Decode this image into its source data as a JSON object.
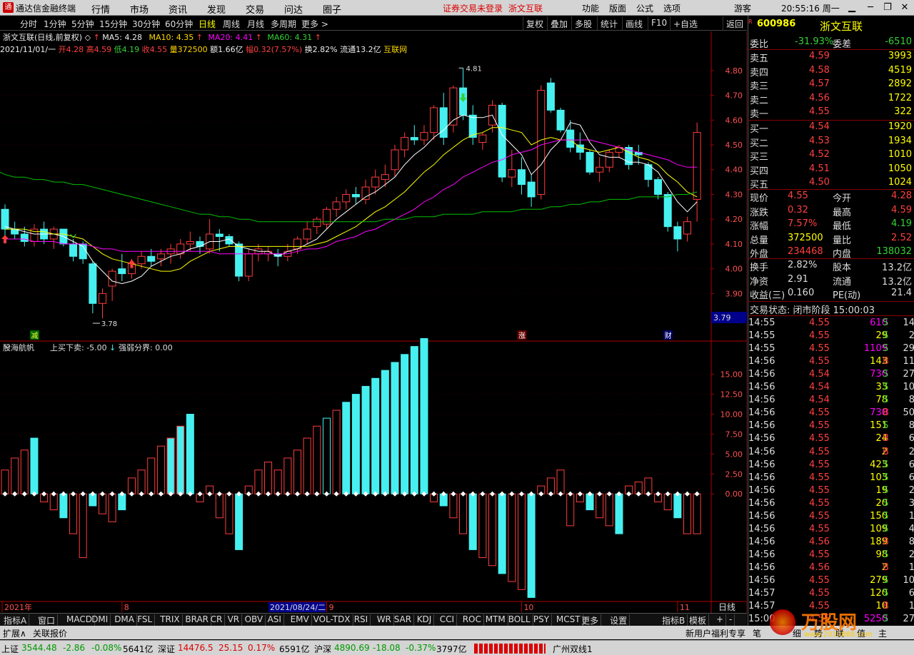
{
  "titlebar": {
    "app": "通达信金融终端",
    "menus": [
      "行情",
      "市场",
      "资讯",
      "发现",
      "交易",
      "问达",
      "圈子"
    ],
    "warn": "证券交易未登录",
    "stock": "浙文互联",
    "right": [
      "功能",
      "版面",
      "公式",
      "选项"
    ],
    "guest": "游客",
    "clock": "20:55:16 周一"
  },
  "toolbar": {
    "periods": [
      "分时",
      "1分钟",
      "5分钟",
      "15分钟",
      "30分钟",
      "60分钟",
      "日线",
      "周线",
      "月线",
      "多周期",
      "更多 >"
    ],
    "active": "日线",
    "buttons": [
      "复权",
      "叠加",
      "多股",
      "统计",
      "画线",
      "F10",
      "+自选",
      "返回"
    ]
  },
  "chart": {
    "name": "浙文互联(日线,前复权)",
    "ma5": "MA5: 4.28",
    "ma10": "MA10: 4.35",
    "ma20": "MA20: 4.41",
    "ma60": "MA60: 4.31",
    "quote": {
      "date": "2021/11/01/一",
      "open": "开4.28",
      "high": "高4.59",
      "low": "低4.19",
      "close": "收4.55",
      "vol": "量372500",
      "amt": "额1.66亿",
      "amp": "幅0.32(7.57%)",
      "turn": "换2.82%",
      "float": "流通13.2亿",
      "tag": "互联网"
    },
    "ylabels": [
      "4.80",
      "4.70",
      "4.60",
      "4.50",
      "4.40",
      "4.30",
      "4.20",
      "4.10",
      "4.00",
      "3.90"
    ],
    "cursor_price": "3.79",
    "high_mark": "4.81",
    "low_mark": "3.78",
    "events": [
      "减",
      "涨",
      "财"
    ],
    "xlabels": [
      "2021年",
      "8",
      "9",
      "10",
      "11"
    ],
    "cursor_date": "2021/08/24/二",
    "ind_name": "股海航帆",
    "ind_p1": "上买下卖: -5.00",
    "ind_arrow": "↓",
    "ind_p2": "强弱分界: 0.00",
    "ind_ylabels": [
      "15.00",
      "12.50",
      "10.00",
      "7.50",
      "5.00",
      "2.50",
      "0.00"
    ],
    "corner": "日线"
  },
  "chart_data": {
    "type": "candlestick",
    "candles": [
      [
        4.24,
        4.26,
        4.13,
        4.16
      ],
      [
        4.16,
        4.19,
        4.12,
        4.14
      ],
      [
        4.14,
        4.17,
        4.09,
        4.11
      ],
      [
        4.11,
        4.18,
        4.09,
        4.16
      ],
      [
        4.16,
        4.19,
        4.1,
        4.12
      ],
      [
        4.12,
        4.17,
        4.08,
        4.16
      ],
      [
        4.16,
        4.16,
        4.09,
        4.1
      ],
      [
        4.1,
        4.12,
        4.03,
        4.05
      ],
      [
        4.1,
        4.11,
        4.02,
        4.04
      ],
      [
        4.02,
        4.03,
        3.82,
        3.86
      ],
      [
        3.86,
        3.92,
        3.8,
        3.9
      ],
      [
        3.93,
        4.0,
        3.87,
        3.99
      ],
      [
        4.0,
        4.06,
        3.95,
        3.98
      ],
      [
        3.98,
        4.04,
        3.96,
        4.02
      ],
      [
        4.02,
        4.07,
        4.0,
        4.05
      ],
      [
        4.05,
        4.08,
        4.01,
        4.03
      ],
      [
        4.04,
        4.08,
        4.01,
        4.06
      ],
      [
        4.06,
        4.1,
        4.02,
        4.08
      ],
      [
        4.06,
        4.12,
        4.04,
        4.1
      ],
      [
        4.1,
        4.15,
        4.07,
        4.11
      ],
      [
        4.11,
        4.13,
        4.06,
        4.09
      ],
      [
        4.08,
        4.2,
        4.06,
        4.14
      ],
      [
        4.14,
        4.16,
        4.07,
        4.13
      ],
      [
        4.13,
        4.14,
        4.09,
        4.1
      ],
      [
        4.1,
        4.11,
        3.95,
        3.97
      ],
      [
        3.97,
        4.08,
        3.95,
        4.06
      ],
      [
        4.06,
        4.1,
        4.03,
        4.08
      ],
      [
        4.06,
        4.09,
        4.03,
        4.07
      ],
      [
        4.06,
        4.08,
        4.01,
        4.05
      ],
      [
        4.05,
        4.1,
        4.03,
        4.07
      ],
      [
        4.08,
        4.13,
        4.06,
        4.12
      ],
      [
        4.12,
        4.19,
        4.1,
        4.16
      ],
      [
        4.17,
        4.21,
        4.14,
        4.2
      ],
      [
        4.18,
        4.25,
        4.16,
        4.24
      ],
      [
        4.24,
        4.29,
        4.21,
        4.27
      ],
      [
        4.27,
        4.32,
        4.24,
        4.3
      ],
      [
        4.3,
        4.33,
        4.26,
        4.29
      ],
      [
        4.28,
        4.36,
        4.26,
        4.33
      ],
      [
        4.33,
        4.4,
        4.3,
        4.37
      ],
      [
        4.36,
        4.42,
        4.33,
        4.38
      ],
      [
        4.4,
        4.5,
        4.37,
        4.48
      ],
      [
        4.48,
        4.55,
        4.45,
        4.53
      ],
      [
        4.53,
        4.58,
        4.5,
        4.52
      ],
      [
        4.52,
        4.58,
        4.5,
        4.55
      ],
      [
        4.55,
        4.66,
        4.52,
        4.65
      ],
      [
        4.65,
        4.71,
        4.5,
        4.53
      ],
      [
        4.58,
        4.74,
        4.55,
        4.73
      ],
      [
        4.73,
        4.81,
        4.6,
        4.62
      ],
      [
        4.62,
        4.66,
        4.5,
        4.53
      ],
      [
        4.51,
        4.55,
        4.48,
        4.54
      ],
      [
        4.58,
        4.68,
        4.55,
        4.66
      ],
      [
        4.66,
        4.67,
        4.35,
        4.37
      ],
      [
        4.37,
        4.48,
        4.33,
        4.4
      ],
      [
        4.4,
        4.45,
        4.3,
        4.34
      ],
      [
        4.35,
        4.38,
        4.25,
        4.29
      ],
      [
        4.3,
        4.74,
        4.28,
        4.72
      ],
      [
        4.75,
        4.77,
        4.63,
        4.64
      ],
      [
        4.64,
        4.65,
        4.55,
        4.56
      ],
      [
        4.56,
        4.6,
        4.47,
        4.49
      ],
      [
        4.5,
        4.55,
        4.44,
        4.47
      ],
      [
        4.47,
        4.48,
        4.38,
        4.39
      ],
      [
        4.39,
        4.45,
        4.35,
        4.41
      ],
      [
        4.41,
        4.48,
        4.39,
        4.47
      ],
      [
        4.47,
        4.5,
        4.45,
        4.49
      ],
      [
        4.49,
        4.5,
        4.4,
        4.42
      ],
      [
        4.47,
        4.5,
        4.42,
        4.46
      ],
      [
        4.42,
        4.43,
        4.33,
        4.36
      ],
      [
        4.36,
        4.37,
        4.28,
        4.3
      ],
      [
        4.3,
        4.31,
        4.15,
        4.17
      ],
      [
        4.17,
        4.19,
        4.07,
        4.12
      ],
      [
        4.14,
        4.21,
        4.11,
        4.19
      ],
      [
        4.28,
        4.59,
        4.19,
        4.55
      ]
    ],
    "ma5": [
      4.17,
      4.16,
      4.15,
      4.14,
      4.14,
      4.14,
      4.13,
      4.11,
      4.09,
      4.03,
      3.99,
      3.95,
      3.94,
      3.95,
      3.97,
      4.01,
      4.03,
      4.05,
      4.06,
      4.08,
      4.09,
      4.11,
      4.11,
      4.12,
      4.09,
      4.08,
      4.07,
      4.07,
      4.05,
      4.07,
      4.08,
      4.1,
      4.12,
      4.16,
      4.2,
      4.23,
      4.26,
      4.29,
      4.31,
      4.34,
      4.37,
      4.42,
      4.46,
      4.49,
      4.53,
      4.56,
      4.6,
      4.62,
      4.61,
      4.61,
      4.62,
      4.54,
      4.5,
      4.46,
      4.38,
      4.42,
      4.48,
      4.52,
      4.59,
      4.58,
      4.51,
      4.46,
      4.45,
      4.45,
      4.43,
      4.43,
      4.42,
      4.39,
      4.33,
      4.27,
      4.23,
      4.27
    ],
    "ma10": [
      4.16,
      4.16,
      4.16,
      4.15,
      4.15,
      4.14,
      4.14,
      4.13,
      4.12,
      4.09,
      4.06,
      4.04,
      4.03,
      4.02,
      4.01,
      4.0,
      3.99,
      3.99,
      4.0,
      4.03,
      4.05,
      4.07,
      4.08,
      4.09,
      4.09,
      4.09,
      4.09,
      4.09,
      4.09,
      4.09,
      4.09,
      4.09,
      4.1,
      4.11,
      4.13,
      4.15,
      4.17,
      4.2,
      4.23,
      4.25,
      4.28,
      4.31,
      4.35,
      4.39,
      4.42,
      4.46,
      4.49,
      4.52,
      4.54,
      4.55,
      4.57,
      4.57,
      4.56,
      4.55,
      4.5,
      4.52,
      4.53,
      4.52,
      4.52,
      4.49,
      4.48,
      4.47,
      4.48,
      4.49,
      4.47,
      4.45,
      4.44,
      4.42,
      4.38,
      4.35,
      4.31,
      4.29
    ],
    "ma20": [
      4.12,
      4.12,
      4.12,
      4.11,
      4.11,
      4.11,
      4.1,
      4.1,
      4.1,
      4.09,
      4.08,
      4.08,
      4.07,
      4.07,
      4.07,
      4.07,
      4.07,
      4.07,
      4.07,
      4.07,
      4.07,
      4.07,
      4.06,
      4.06,
      4.06,
      4.06,
      4.06,
      4.06,
      4.06,
      4.06,
      4.07,
      4.08,
      4.08,
      4.09,
      4.11,
      4.12,
      4.13,
      4.15,
      4.16,
      4.18,
      4.2,
      4.22,
      4.24,
      4.27,
      4.29,
      4.32,
      4.34,
      4.37,
      4.39,
      4.41,
      4.43,
      4.44,
      4.46,
      4.47,
      4.48,
      4.5,
      4.51,
      4.52,
      4.52,
      4.52,
      4.52,
      4.51,
      4.5,
      4.49,
      4.48,
      4.47,
      4.46,
      4.45,
      4.44,
      4.42,
      4.41,
      4.41
    ],
    "ma60": [
      4.38,
      4.37,
      4.37,
      4.36,
      4.36,
      4.35,
      4.35,
      4.34,
      4.34,
      4.33,
      4.32,
      4.31,
      4.3,
      4.29,
      4.28,
      4.27,
      4.26,
      4.25,
      4.24,
      4.23,
      4.22,
      4.22,
      4.21,
      4.21,
      4.2,
      4.2,
      4.19,
      4.19,
      4.19,
      4.19,
      4.19,
      4.19,
      4.19,
      4.19,
      4.19,
      4.19,
      4.19,
      4.19,
      4.19,
      4.2,
      4.2,
      4.2,
      4.21,
      4.21,
      4.21,
      4.22,
      4.22,
      4.22,
      4.22,
      4.23,
      4.23,
      4.23,
      4.23,
      4.24,
      4.24,
      4.24,
      4.25,
      4.25,
      4.26,
      4.26,
      4.27,
      4.27,
      4.28,
      4.28,
      4.28,
      4.29,
      4.29,
      4.29,
      4.29,
      4.3,
      4.3,
      4.31
    ],
    "indicator": [
      3,
      4.5,
      5.5,
      7,
      -1,
      -2,
      -3,
      -5,
      -8,
      -1.5,
      -2.5,
      -3.5,
      -2,
      2,
      3,
      4.5,
      6,
      7,
      8.5,
      10,
      -1,
      1,
      -3,
      -5,
      -7,
      1,
      3,
      4,
      3,
      4.5,
      5.5,
      7,
      8.5,
      9.5,
      10.5,
      11.5,
      12.5,
      13.5,
      14.5,
      15.5,
      16.5,
      17.5,
      18.5,
      19.5,
      -1,
      -1.5,
      -3,
      -5,
      -7,
      -8,
      -9,
      -10,
      -11,
      -12,
      -13,
      1,
      2,
      3,
      -4,
      -1,
      -2,
      -3,
      -4,
      -5,
      1,
      1.5,
      2,
      -1,
      -2,
      -3,
      -5,
      -5
    ],
    "ylim": [
      3.76,
      4.86
    ],
    "ind_ylim": [
      -13.5,
      19
    ]
  },
  "rightpanel": {
    "code": "600986",
    "name": "浙文互联",
    "weibi": {
      "l1": "委比",
      "v1": "-31.93%",
      "l2": "委差",
      "v2": "-6510"
    },
    "asks": [
      {
        "l": "卖五",
        "p": "4.59",
        "v": "3993"
      },
      {
        "l": "卖四",
        "p": "4.58",
        "v": "4519"
      },
      {
        "l": "卖三",
        "p": "4.57",
        "v": "2892"
      },
      {
        "l": "卖二",
        "p": "4.56",
        "v": "1722"
      },
      {
        "l": "卖一",
        "p": "4.55",
        "v": "322"
      }
    ],
    "bids": [
      {
        "l": "买一",
        "p": "4.54",
        "v": "1920"
      },
      {
        "l": "买二",
        "p": "4.53",
        "v": "1934"
      },
      {
        "l": "买三",
        "p": "4.52",
        "v": "1010"
      },
      {
        "l": "买四",
        "p": "4.51",
        "v": "1050"
      },
      {
        "l": "买五",
        "p": "4.50",
        "v": "1024"
      }
    ],
    "stats1": [
      [
        "现价",
        "4.55",
        "今开",
        "4.28"
      ],
      [
        "涨跌",
        "0.32",
        "最高",
        "4.59"
      ],
      [
        "涨幅",
        "7.57%",
        "最低",
        "4.19"
      ],
      [
        "总量",
        "372500",
        "量比",
        "2.52"
      ],
      [
        "外盘",
        "234468",
        "内盘",
        "138032"
      ]
    ],
    "stats2": [
      [
        "换手",
        "2.82%",
        "股本",
        "13.2亿"
      ],
      [
        "净资",
        "2.91",
        "流通",
        "13.2亿"
      ],
      [
        "收益(三)",
        "0.160",
        "PE(动)",
        "21.4"
      ]
    ],
    "status": "交易状态: 闭市阶段 15:00:03",
    "ticks": [
      [
        "14:55",
        "4.55",
        "610",
        "S",
        "14"
      ],
      [
        "14:55",
        "4.55",
        "29",
        "S",
        "2"
      ],
      [
        "14:55",
        "4.55",
        "1109",
        "S",
        "29"
      ],
      [
        "14:56",
        "4.55",
        "143",
        "B",
        "11"
      ],
      [
        "14:56",
        "4.54",
        "730",
        "S",
        "27"
      ],
      [
        "14:56",
        "4.54",
        "33",
        "S",
        "10"
      ],
      [
        "14:56",
        "4.54",
        "78",
        "S",
        "8"
      ],
      [
        "14:56",
        "4.55",
        "730",
        "B",
        "50"
      ],
      [
        "14:56",
        "4.55",
        "151",
        "S",
        "8"
      ],
      [
        "14:56",
        "4.55",
        "24",
        "B",
        "6"
      ],
      [
        "14:56",
        "4.55",
        "2",
        "B",
        "2"
      ],
      [
        "14:56",
        "4.55",
        "423",
        "S",
        "6"
      ],
      [
        "14:56",
        "4.55",
        "103",
        "S",
        "6"
      ],
      [
        "14:56",
        "4.55",
        "19",
        "S",
        "2"
      ],
      [
        "14:56",
        "4.55",
        "20",
        "S",
        "3"
      ],
      [
        "14:56",
        "4.55",
        "150",
        "S",
        "1"
      ],
      [
        "14:56",
        "4.55",
        "109",
        "S",
        "4"
      ],
      [
        "14:56",
        "4.56",
        "189",
        "B",
        "8"
      ],
      [
        "14:56",
        "4.55",
        "98",
        "S",
        "2"
      ],
      [
        "14:56",
        "4.56",
        "2",
        "B",
        "1"
      ],
      [
        "14:56",
        "4.55",
        "279",
        "S",
        "10"
      ],
      [
        "14:57",
        "4.55",
        "120",
        "S",
        "6"
      ],
      [
        "14:57",
        "4.55",
        "10",
        "B",
        "1"
      ],
      [
        "15:00",
        "4.55",
        "5250",
        "S",
        "27"
      ]
    ]
  },
  "bottomtabs": [
    "指标A",
    "窗口",
    "MACD",
    "DMI",
    "DMA",
    "FSL",
    "TRIX",
    "BRAR",
    "CR",
    "VR",
    "OBV",
    "ASI",
    "EMV",
    "VOL-TDX",
    "RSI",
    "WR",
    "SAR",
    "KDJ",
    "CCI",
    "ROC",
    "MTM",
    "BOLL",
    "PSY",
    "MCST",
    "更多",
    "设置"
  ],
  "bottomright": [
    "指标B",
    "模板",
    "+",
    "-"
  ],
  "extbar": {
    "left": [
      "扩展∧",
      "关联报价"
    ],
    "right": "新用户福利专享",
    "tabs": [
      "笔",
      "细",
      "势",
      "联",
      "值",
      "主"
    ]
  },
  "watermark": {
    "text": "万股网",
    "url": "www.2010888.com"
  },
  "statusbar": {
    "items": [
      {
        "n": "上证",
        "v": "3544.48",
        "c": "-2.86",
        "p": "-0.08%",
        "a": "5641亿"
      },
      {
        "n": "深证",
        "v": "14476.5",
        "c": "25.15",
        "p": "0.17%",
        "a": "6591亿"
      },
      {
        "n": "沪深",
        "v": "4890.69",
        "c": "-18.08",
        "p": "-0.37%",
        "a": "3797亿"
      }
    ],
    "line": "广州双线1"
  },
  "colors": {
    "up": "#ff3c3c",
    "down": "#46f0f0",
    "ma5": "#ffffff",
    "ma10": "#ffff00",
    "ma20": "#ff00ff",
    "ma60": "#00c000",
    "axis": "#b00000",
    "grid": "#600000"
  }
}
